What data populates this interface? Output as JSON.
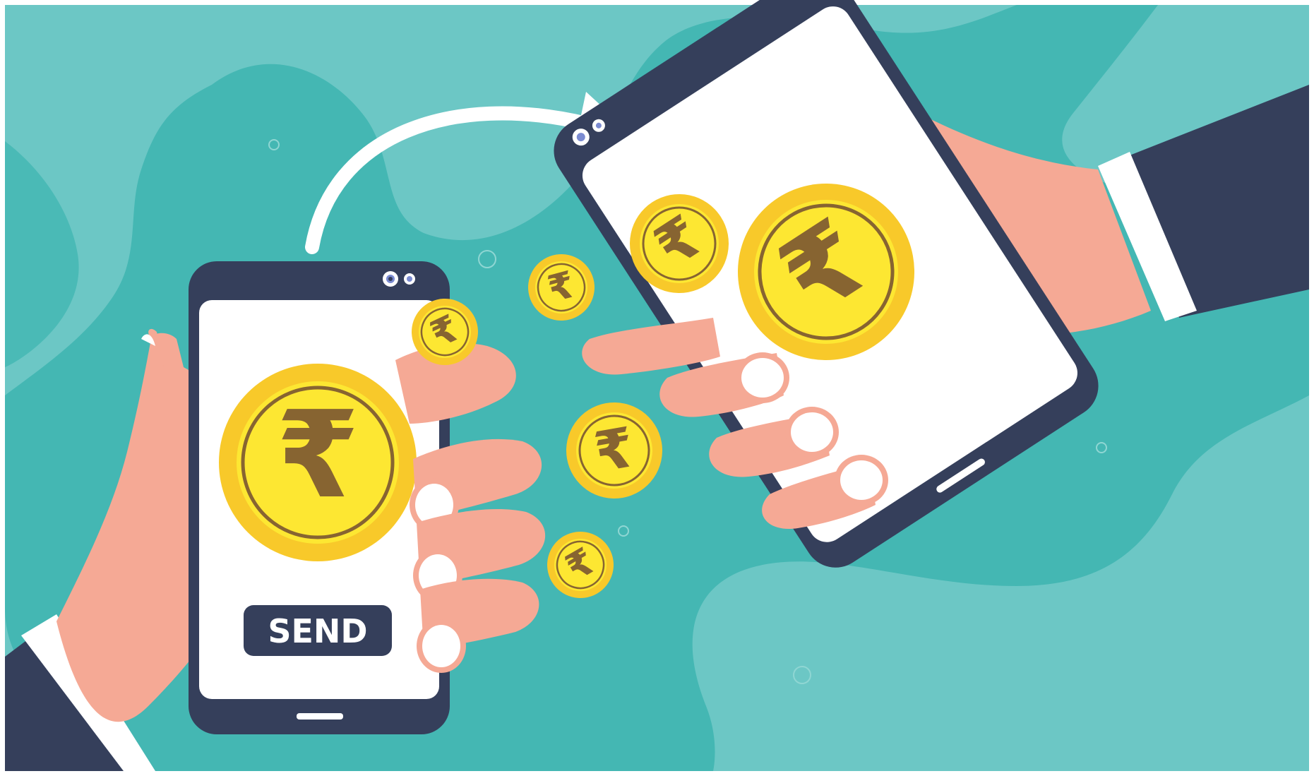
{
  "illustration": {
    "send_button_label": "SEND",
    "currency_symbol": "₹",
    "colors": {
      "background_light": "#6cc7c5",
      "background_blob": "#44b7b3",
      "phone_body": "#353f5b",
      "screen": "#ffffff",
      "skin": "#f5a995",
      "nail": "#ffffff",
      "sleeve": "#353f5b",
      "cuff": "#ffffff",
      "coin_outer": "#f8c92a",
      "coin_inner": "#fde732",
      "coin_symbol": "#876431",
      "arrow": "#ffffff"
    },
    "icons": [
      "rupee-coin-icon",
      "transfer-arrow-icon",
      "camera-icon"
    ]
  }
}
